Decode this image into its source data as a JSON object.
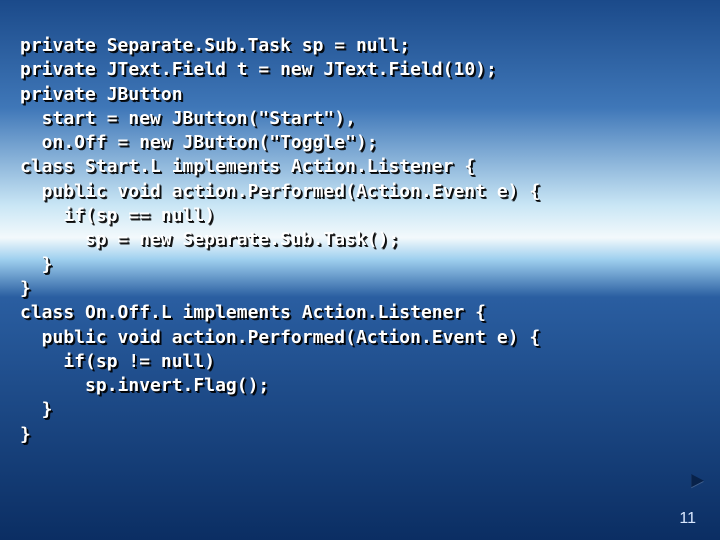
{
  "slide": {
    "code_lines": [
      "private Separate.Sub.Task sp = null;",
      "private JText.Field t = new JText.Field(10);",
      "private JButton",
      "  start = new JButton(\"Start\"),",
      "  on.Off = new JButton(\"Toggle\");",
      "class Start.L implements Action.Listener {",
      "  public void action.Performed(Action.Event e) {",
      "    if(sp == null)",
      "      sp = new Separate.Sub.Task();",
      "  }",
      "}",
      "class On.Off.L implements Action.Listener {",
      "  public void action.Performed(Action.Event e) {",
      "    if(sp != null)",
      "      sp.invert.Flag();",
      "  }",
      "}"
    ],
    "arrow_glyph": "►",
    "page_number": "11"
  }
}
